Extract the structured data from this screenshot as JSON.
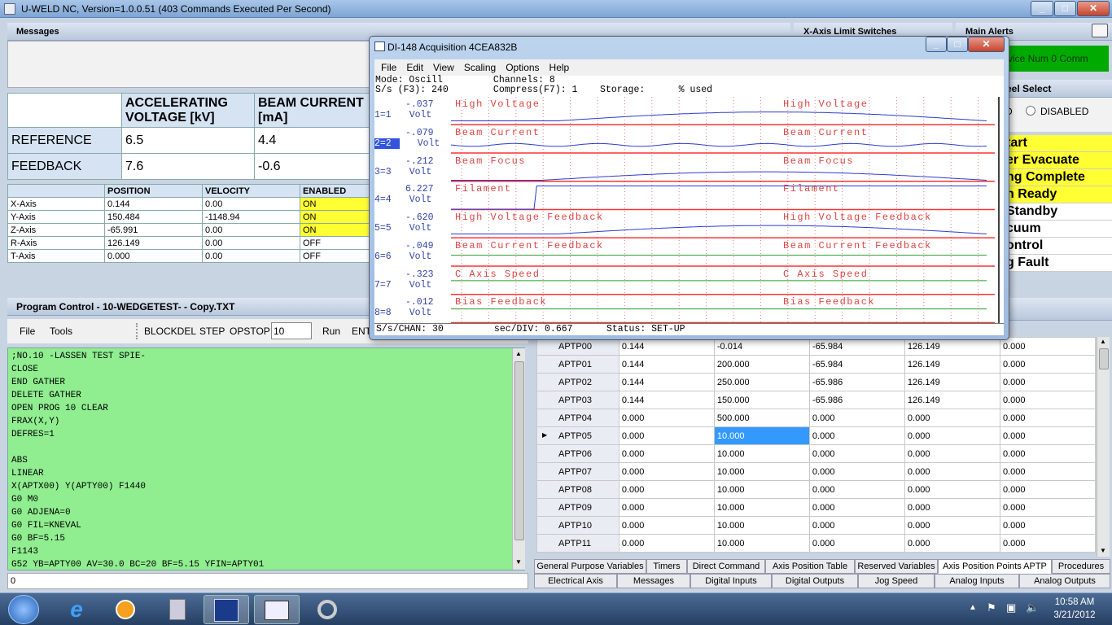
{
  "window": {
    "title": "U-WELD NC, Version=1.0.0.51 (403 Commands Executed Per Second)"
  },
  "messages": {
    "header": "Messages"
  },
  "xlimit": {
    "header": "X-Axis Limit Switches"
  },
  "alerts": {
    "header": "Main Alerts",
    "device": "vice Num 0 Comm",
    "wheel_header": "eel Select",
    "wheel_d": "D",
    "wheel_disabled": "DISABLED",
    "items": [
      {
        "label": "tart",
        "style": "y"
      },
      {
        "label": "er Evacuate",
        "style": "y"
      },
      {
        "label": "ng Complete",
        "style": "y"
      },
      {
        "label": "n Ready",
        "style": "y"
      },
      {
        "label": "Standby",
        "style": "w"
      },
      {
        "label": "cuum",
        "style": "w"
      },
      {
        "label": "ontrol",
        "style": "w"
      },
      {
        "label": "g Fault",
        "style": "w"
      }
    ]
  },
  "beam": {
    "col1": "ACCELERATING VOLTAGE [kV]",
    "col2": "BEAM CURRENT [mA]",
    "rows": [
      {
        "label": "REFERENCE",
        "v1": "6.5",
        "v2": "4.4"
      },
      {
        "label": "FEEDBACK",
        "v1": "7.6",
        "v2": "-0.6"
      }
    ]
  },
  "axes": {
    "headers": [
      "",
      "POSITION",
      "VELOCITY",
      "ENABLED"
    ],
    "rows": [
      {
        "name": "X-Axis",
        "pos": "0.144",
        "vel": "0.00",
        "en": "ON"
      },
      {
        "name": "Y-Axis",
        "pos": "150.484",
        "vel": "-1148.94",
        "en": "ON"
      },
      {
        "name": "Z-Axis",
        "pos": "-65.991",
        "vel": "0.00",
        "en": "ON"
      },
      {
        "name": "R-Axis",
        "pos": "126.149",
        "vel": "0.00",
        "en": "OFF"
      },
      {
        "name": "T-Axis",
        "pos": "0.000",
        "vel": "0.00",
        "en": "OFF"
      }
    ]
  },
  "program": {
    "header": "Program Control - 10-WEDGETEST- - Copy.TXT",
    "toolbar": {
      "file": "File",
      "tools": "Tools",
      "blockdel": "BLOCKDEL",
      "step": "STEP",
      "opstop": "OPSTOP",
      "input_value": "10",
      "run": "Run",
      "ent": "ENT"
    },
    "code": ";NO.10 -LASSEN TEST SPIE-\nCLOSE\nEND GATHER\nDELETE GATHER\nOPEN PROG 10 CLEAR\nFRAX(X,Y)\nDEFRES=1\n\nABS\nLINEAR\nX(APTX00) Y(APTY00) F1440\nG0 M0\nG0 ADJENA=0\nG0 FIL=KNEVAL\nG0 BF=5.15\nF1143\nG52 YB=APTY00 AV=30.0 BC=20 BF=5.15 YFIN=APTY01",
    "status": "0"
  },
  "grid": {
    "rows": [
      {
        "name": "APTP00",
        "c": [
          "0.144",
          "-0.014",
          "-65.984",
          "126.149",
          "0.000"
        ]
      },
      {
        "name": "APTP01",
        "c": [
          "0.144",
          "200.000",
          "-65.984",
          "126.149",
          "0.000"
        ]
      },
      {
        "name": "APTP02",
        "c": [
          "0.144",
          "250.000",
          "-65.986",
          "126.149",
          "0.000"
        ]
      },
      {
        "name": "APTP03",
        "c": [
          "0.144",
          "150.000",
          "-65.986",
          "126.149",
          "0.000"
        ]
      },
      {
        "name": "APTP04",
        "c": [
          "0.000",
          "500.000",
          "0.000",
          "0.000",
          "0.000"
        ]
      },
      {
        "name": "APTP05",
        "c": [
          "0.000",
          "10.000",
          "0.000",
          "0.000",
          "0.000"
        ]
      },
      {
        "name": "APTP06",
        "c": [
          "0.000",
          "10.000",
          "0.000",
          "0.000",
          "0.000"
        ]
      },
      {
        "name": "APTP07",
        "c": [
          "0.000",
          "10.000",
          "0.000",
          "0.000",
          "0.000"
        ]
      },
      {
        "name": "APTP08",
        "c": [
          "0.000",
          "10.000",
          "0.000",
          "0.000",
          "0.000"
        ]
      },
      {
        "name": "APTP09",
        "c": [
          "0.000",
          "10.000",
          "0.000",
          "0.000",
          "0.000"
        ]
      },
      {
        "name": "APTP10",
        "c": [
          "0.000",
          "10.000",
          "0.000",
          "0.000",
          "0.000"
        ]
      },
      {
        "name": "APTP11",
        "c": [
          "0.000",
          "10.000",
          "0.000",
          "0.000",
          "0.000"
        ]
      }
    ],
    "selected_row": 5
  },
  "tabs_row1": [
    "General Purpose Variables",
    "Timers",
    "Direct Command",
    "Axis Position Table",
    "Reserved Variables",
    "Axis Position Points APTP",
    "Procedures"
  ],
  "tabs_row2": [
    "Electrical Axis",
    "Messages",
    "Digital Inputs",
    "Digital Outputs",
    "Jog Speed",
    "Analog Inputs",
    "Analog Outputs"
  ],
  "di148": {
    "title": "DI-148 Acquisition 4CEA832B",
    "menu": [
      "File",
      "Edit",
      "View",
      "Scaling",
      "Options",
      "Help"
    ],
    "info_line1": "Mode: Oscill         Channels: 8",
    "info_line2": "S/s (F3): 240        Compress(F7): 1    Storage:      % used",
    "status": "S/s/CHAN: 30         sec/DIV: 0.667      Status: SET-UP",
    "channels": [
      {
        "id": "1=1",
        "value": "-.037",
        "unit": "Volt",
        "name": "High Voltage"
      },
      {
        "id": "2=2",
        "value": "-.079",
        "unit": "Volt",
        "name": "Beam Current"
      },
      {
        "id": "3=3",
        "value": "-.212",
        "unit": "Volt",
        "name": "Beam Focus"
      },
      {
        "id": "4=4",
        "value": "6.227",
        "unit": "Volt",
        "name": "Filament"
      },
      {
        "id": "5=5",
        "value": "-.620",
        "unit": "Volt",
        "name": "High Voltage Feedback"
      },
      {
        "id": "6=6",
        "value": "-.049",
        "unit": "Volt",
        "name": "Beam Current Feedback"
      },
      {
        "id": "7=7",
        "value": "-.323",
        "unit": "Volt",
        "name": "C Axis Speed"
      },
      {
        "id": "8=8",
        "value": "-.012",
        "unit": "Volt",
        "name": "Bias Feedback"
      }
    ]
  },
  "taskbar": {
    "time": "10:58 AM",
    "date": "3/21/2012"
  },
  "colors": {
    "green": "#90ee90",
    "yellow": "#ffff33",
    "alertgreen": "#00aa00",
    "select": "#3399ff"
  }
}
